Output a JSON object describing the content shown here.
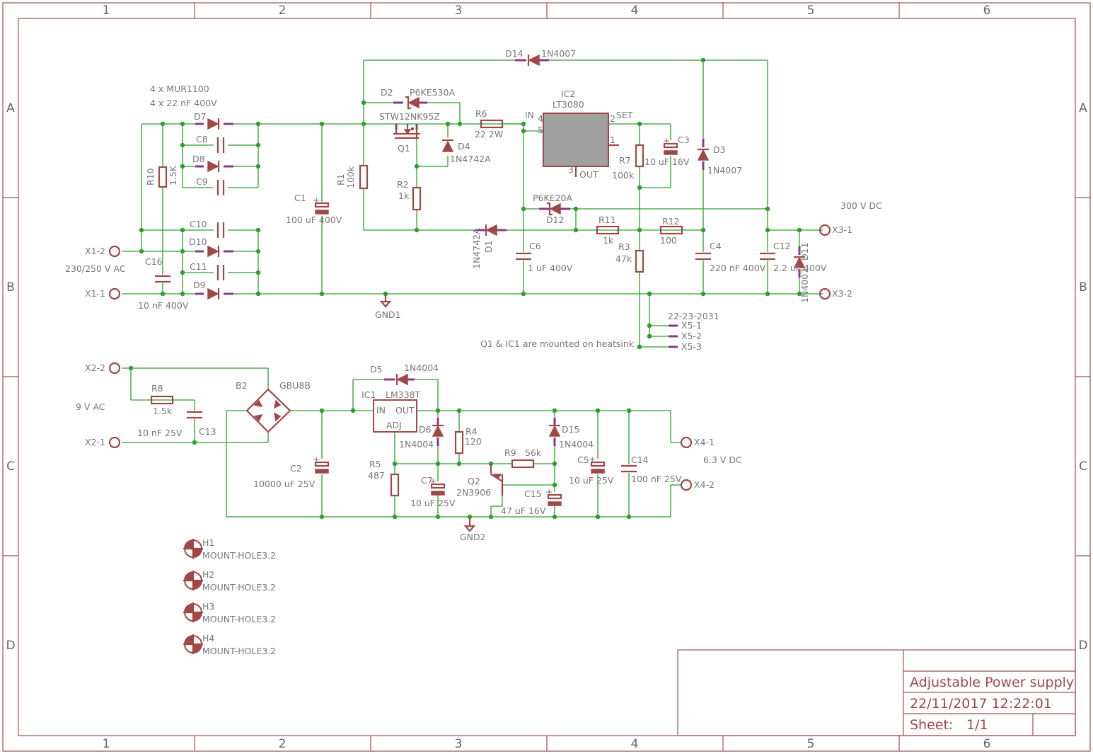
{
  "colors": {
    "frame": "#a05050",
    "wire": "#2e9e2e",
    "symbol": "#a04848",
    "pin": "#8a3a8a",
    "text": "#777777",
    "ic_body": "#a0a0a0"
  },
  "frame": {
    "columns": [
      "1",
      "2",
      "3",
      "4",
      "5",
      "6"
    ],
    "rows": [
      "A",
      "B",
      "C",
      "D"
    ]
  },
  "title_block": {
    "title": "Adjustable Power supply",
    "date": "22/11/2017 12:22:01",
    "sheet_label": "Sheet:",
    "sheet_value": "1/1"
  },
  "notes": {
    "rectifier_diodes": "4 x MUR1100",
    "rectifier_caps": "4 x 22 nF 400V",
    "hv_output": "300 V DC",
    "ac_in_hv": "230/250 V AC",
    "ac_in_lv": "9 V AC",
    "lv_output": "6.3 V DC",
    "heatsink": "Q1 & IC1 are mounted on heatsink",
    "connector": "22-23-2031"
  },
  "terminals": {
    "x1_2": "X1-2",
    "x1_1": "X1-1",
    "x2_2": "X2-2",
    "x2_1": "X2-1",
    "x3_1": "X3-1",
    "x3_2": "X3-2",
    "x4_1": "X4-1",
    "x4_2": "X4-2",
    "x5_1": "X5-1",
    "x5_2": "X5-2",
    "x5_3": "X5-3"
  },
  "grounds": {
    "gnd1": "GND1",
    "gnd2": "GND2"
  },
  "parts": {
    "d7": "D7",
    "d8": "D8",
    "d9": "D9",
    "d10": "D10",
    "c8": "C8",
    "c9": "C9",
    "c10": "C10",
    "c11": "C11",
    "r10": "R10",
    "r10_val": "1.5K",
    "c16": "C16",
    "c16_val": "10 nF 400V",
    "c1": "C1",
    "c1_val": "100 uF 400V",
    "r1": "R1",
    "r1_val": "100k",
    "d2": "D2",
    "d2_val": "P6KE530A",
    "q1": "Q1",
    "q1_val": "STW12NK95Z",
    "d4": "D4",
    "d4_val": "1N4742A",
    "r2": "R2",
    "r2_val": "1k",
    "r6": "R6",
    "r6_val": "22 2W",
    "d1": "D1",
    "d1_val": "1N4742A",
    "d14": "D14",
    "d14_val": "1N4007",
    "ic2": "IC2",
    "ic2_val": "LT3080",
    "ic2_in": "IN",
    "ic2_set": "SET",
    "ic2_out": "OUT",
    "ic2_p4": "4",
    "ic2_p5": "5",
    "ic2_p2": "2",
    "ic2_p1": "1",
    "ic2_p3": "3",
    "c6": "C6",
    "c6_val": "1 uF 400V",
    "d12": "D12",
    "d12_val": "P6KE20A",
    "r11": "R11",
    "r11_val": "1k",
    "r7": "R7",
    "r7_val": "100k",
    "c3": "C3",
    "c3_val": "10 uF 16V",
    "r12": "R12",
    "r12_val": "100",
    "r3": "R3",
    "r3_val": "47k",
    "d3": "D3",
    "d3_val": "1N4007",
    "c4": "C4",
    "c4_val": "220 nF 400V",
    "c12": "C12",
    "c12_val": "2.2 uF 400V",
    "d11": "D11",
    "d11_val": "1N4007",
    "r8": "R8",
    "r8_val": "1.5k",
    "c13": "C13",
    "c13_val": "10 nF 25V",
    "b2": "B2",
    "b2_val": "GBU8B",
    "c2": "C2",
    "c2_val": "10000 uF 25V",
    "d5": "D5",
    "d5_val": "1N4004",
    "ic1": "IC1",
    "ic1_val": "LM338T",
    "ic1_in": "IN",
    "ic1_out": "OUT",
    "ic1_adj": "ADJ",
    "d6": "D6",
    "d6_val": "1N4004",
    "r4": "R4",
    "r4_val": "120",
    "r5": "R5",
    "r5_val": "487",
    "c7": "C7",
    "c7_val": "10 uF 25V",
    "q2": "Q2",
    "q2_val": "2N3906",
    "r9": "R9",
    "r9_val": "56k",
    "d15": "D15",
    "d15_val": "1N4004",
    "c15": "C15",
    "c15_val": "47 uF 16V",
    "c5": "C5",
    "c5_val": "10 uF 25V",
    "c14": "C14",
    "c14_val": "100 nF 25V",
    "h1": "H1",
    "h2": "H2",
    "h3": "H3",
    "h4": "H4",
    "mount_hole": "MOUNT-HOLE3.2"
  }
}
